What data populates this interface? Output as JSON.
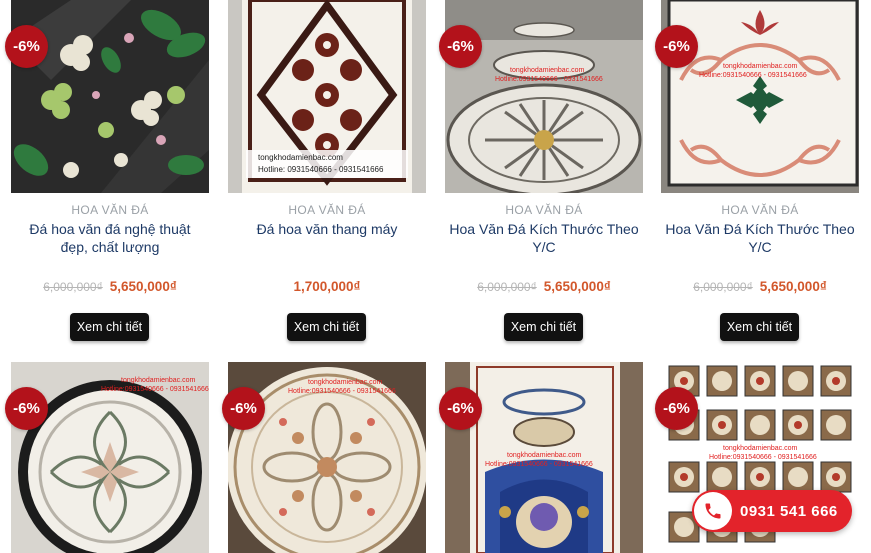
{
  "products": [
    {
      "badge": "-6%",
      "category": "HOA VĂN ĐÁ",
      "title": "Đá hoa văn đá nghệ thuật đẹp, chất lượng",
      "old_price": "6,000,000₫",
      "price": "5,650,000₫",
      "button": "Xem chi tiết"
    },
    {
      "badge": "",
      "category": "HOA VĂN ĐÁ",
      "title": "Đá hoa văn thang máy",
      "old_price": "",
      "price": "1,700,000₫",
      "button": "Xem chi tiết",
      "watermark": [
        "tongkhodamienbac.com",
        "Hotline: 0931540666 - 0931541666"
      ]
    },
    {
      "badge": "-6%",
      "category": "HOA VĂN ĐÁ",
      "title": "Hoa Văn Đá Kích Thước Theo Y/C",
      "old_price": "6,000,000₫",
      "price": "5,650,000₫",
      "button": "Xem chi tiết",
      "watermark": [
        "tongkhodamienbac.com",
        "Hotline:0931540666 - 0931541666"
      ]
    },
    {
      "badge": "-6%",
      "category": "HOA VĂN ĐÁ",
      "title": "Hoa Văn Đá Kích Thước Theo Y/C",
      "old_price": "6,000,000₫",
      "price": "5,650,000₫",
      "button": "Xem chi tiết",
      "watermark": [
        "tongkhodamienbac.com",
        "Hotline:0931540666 - 0931541666"
      ]
    },
    {
      "badge": "-6%",
      "watermark": [
        "tongkhodamienbac.com",
        "Hotline:0931540666 - 0931541666"
      ]
    },
    {
      "badge": "-6%",
      "watermark": [
        "tongkhodamienbac.com",
        "Hotline:0931540666 - 0931541666"
      ]
    },
    {
      "badge": "-6%",
      "watermark": [
        "tongkhodamienbac.com",
        "Hotline:0931540666 - 0931541666"
      ]
    },
    {
      "badge": "-6%",
      "watermark": [
        "tongkhodamienbac.com",
        "Hotline:0931540666 - 0931541666"
      ]
    }
  ],
  "hotline": {
    "number": "0931 541 666",
    "icon": "phone-icon"
  },
  "colors": {
    "badge": "#b3121b",
    "price": "#d2572b",
    "title": "#1e3a66",
    "button": "#111111",
    "hotline": "#e3232b"
  }
}
